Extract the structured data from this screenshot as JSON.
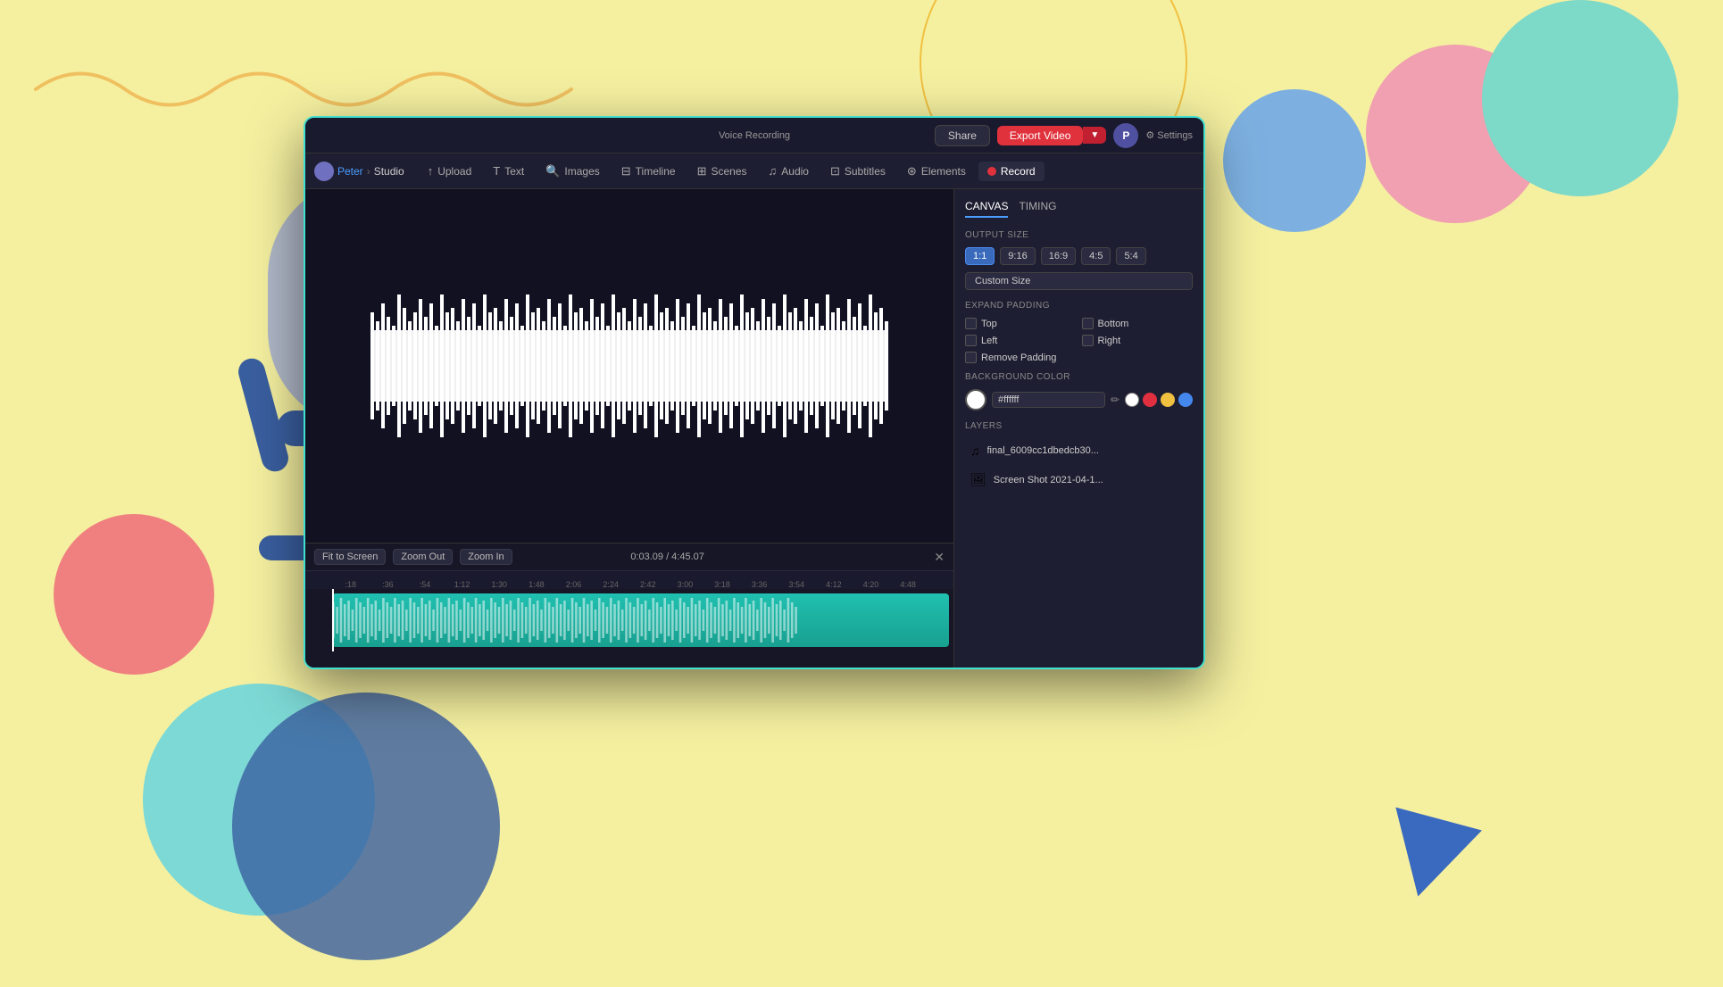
{
  "background": {
    "color": "#f5f0a0"
  },
  "app_window": {
    "title": "Voice Recording"
  },
  "topbar": {
    "share_label": "Share",
    "export_label": "Export Video",
    "settings_label": "⚙ Settings",
    "avatar_label": "P",
    "dropdown_icon": "▼"
  },
  "navbar": {
    "breadcrumb_user": "Peter",
    "breadcrumb_sep": "›",
    "breadcrumb_studio": "Studio",
    "items": [
      {
        "label": "Upload",
        "icon": "↑"
      },
      {
        "label": "Text",
        "icon": "T"
      },
      {
        "label": "Images",
        "icon": "🔍"
      },
      {
        "label": "Timeline",
        "icon": "⊟"
      },
      {
        "label": "Scenes",
        "icon": "⊞"
      },
      {
        "label": "Audio",
        "icon": "♫"
      },
      {
        "label": "Subtitles",
        "icon": "⊡"
      },
      {
        "label": "Elements",
        "icon": "⊛"
      }
    ],
    "record_label": "Record"
  },
  "right_panel": {
    "tab_canvas": "CANVAS",
    "tab_timing": "TIMING",
    "output_size_label": "OUTPUT SIZE",
    "size_options": [
      "1:1",
      "9:16",
      "16:9",
      "4:5",
      "5:4"
    ],
    "active_size": "1:1",
    "custom_size_label": "Custom Size",
    "expand_padding_label": "EXPAND PADDING",
    "padding_options": [
      "Top",
      "Bottom",
      "Left",
      "Right"
    ],
    "remove_padding_label": "Remove Padding",
    "bg_color_label": "BACKGROUND COLOR",
    "bg_color_hex": "#ffffff",
    "bg_color_swatches": [
      "#ffffff",
      "#ff4444",
      "#ffcc00",
      "#4488ff"
    ],
    "layers_label": "LAYERS",
    "layers": [
      {
        "name": "final_6009cc1dbedcb30...",
        "icon": "♫"
      },
      {
        "name": "Screen Shot 2021-04-1...",
        "icon": "🖼"
      }
    ]
  },
  "timeline": {
    "fit_to_screen_label": "Fit to Screen",
    "zoom_out_label": "Zoom Out",
    "zoom_in_label": "Zoom In",
    "time_display": "0:03.09 / 4:45.07",
    "ruler_marks": [
      ":18",
      ":36",
      ":54",
      "1:12",
      "1:30",
      "1:48",
      "2:06",
      "2:24",
      "2:42",
      "3:00",
      "3:18",
      "3:36",
      "3:54",
      "4:12",
      "4:20",
      "4:48"
    ]
  }
}
